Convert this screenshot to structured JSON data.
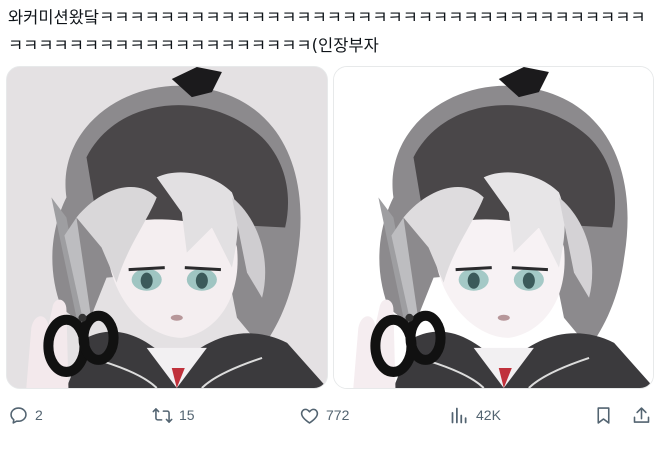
{
  "post": {
    "text": "와커미션왔닼ㅋㅋㅋㅋㅋㅋㅋㅋㅋㅋㅋㅋㅋㅋㅋㅋㅋㅋㅋㅋㅋㅋㅋㅋㅋㅋㅋㅋㅋㅋㅋㅋㅋㅋㅋㅋㅋㅋㅋㅋㅋㅋㅋㅋㅋㅋㅋㅋㅋㅋㅋㅋㅋㅋㅋㅋ(인장부자"
  },
  "media": {
    "images": [
      {
        "icon": "anime-portrait-image",
        "background": "#e4e1e3"
      },
      {
        "icon": "anime-portrait-image",
        "background": "#ffffff"
      }
    ]
  },
  "actions": {
    "reply": {
      "icon": "reply-icon",
      "count": "2"
    },
    "repost": {
      "icon": "repost-icon",
      "count": "15"
    },
    "like": {
      "icon": "heart-icon",
      "count": "772"
    },
    "views": {
      "icon": "analytics-icon",
      "count": "42K"
    },
    "bookmark": {
      "icon": "bookmark-icon"
    },
    "share": {
      "icon": "share-icon"
    }
  },
  "colors": {
    "text": "#0f1419",
    "muted": "#536471",
    "border": "#e7e9ea"
  }
}
